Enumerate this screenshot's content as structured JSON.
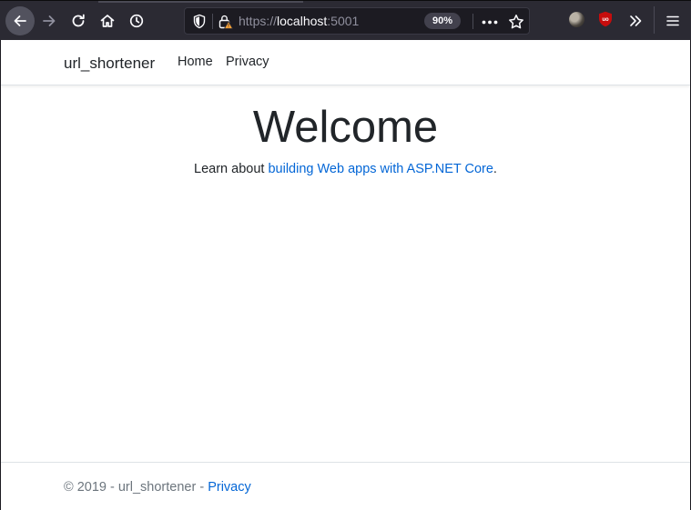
{
  "browser": {
    "url_scheme": "https://",
    "url_host": "localhost",
    "url_port": ":5001",
    "zoom": "90%",
    "icons": [
      "back-arrow-icon",
      "forward-arrow-icon",
      "reload-icon",
      "home-icon",
      "history-clock-icon",
      "tracking-shield-icon",
      "insecure-lock-icon",
      "page-actions-dots-icon",
      "bookmark-star-icon",
      "profile-extension-icon",
      "ublock-origin-icon",
      "overflow-chevron-icon",
      "hamburger-menu-icon"
    ]
  },
  "navbar": {
    "brand": "url_shortener",
    "links": [
      "Home",
      "Privacy"
    ]
  },
  "main": {
    "heading": "Welcome",
    "lead_prefix": "Learn about ",
    "lead_link": "building Web apps with ASP.NET Core",
    "lead_suffix": "."
  },
  "footer": {
    "text": "© 2019 - url_shortener - ",
    "link": "Privacy"
  },
  "colors": {
    "link": "#0366d6",
    "text": "#212529",
    "muted": "#6c757d",
    "chrome": "#2b2a33"
  }
}
